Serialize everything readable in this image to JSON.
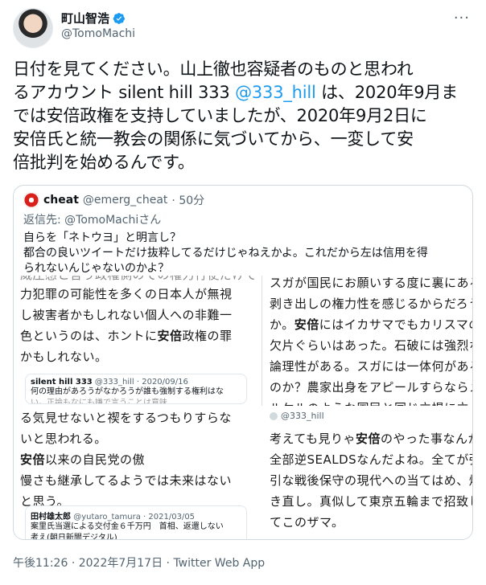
{
  "author": {
    "name": "町山智浩",
    "handle": "@TomoMachi"
  },
  "tweet": {
    "line1": "日付を見てください。山上徹也容疑者のものと思われ",
    "line2_before": "るアカウント silent hill 333 ",
    "line2_mention": "@333_hill",
    "line2_after": " は、2020年9月ま",
    "line3": "では安倍政権を支持していましたが、2020年9月2日に",
    "line4": "安倍氏と統一教会の関係に気づいてから、一変して安",
    "line5": "倍批判を始めるんです。"
  },
  "quote": {
    "name": "cheat",
    "handle": "@emerg_cheat",
    "time": "· 50分",
    "reply_to": "返信先: @TomoMachiさん",
    "text_line1": "自らを「ネトウヨ」と明言し？",
    "text_line2": "都合の良いツイートだけ抜粋してるだけじゃねえかよ。これだから左は信用を得",
    "text_line3": "られないんじゃないのかよ？"
  },
  "images": {
    "left": {
      "top_line0": "威圧感と言う政権側のでの権力行使だけで権",
      "top_line1": "力犯罪の可能性を多くの日本人が無視",
      "top_line2": "し被害者かもしれない個人への非難一",
      "top_line3a": "色というのは、ホントに",
      "top_line3b": "安倍",
      "top_line3c": "政権の罪",
      "top_line4": "かもしれない。",
      "card1_name": "silent hill 333",
      "card1_meta": "@333_hill · 2020/09/16",
      "card1_line1": "何の理由があろうがなかろうが誰も強制する権利はな",
      "card1_line2": "い。正論もなにも嫌で言うことは意味",
      "mid_line1": "る気見せないと禊をするつもりすらな",
      "mid_line2": "いと思われる。",
      "mid_line3a": "安倍",
      "mid_line3b": "以来の自民党の傲",
      "mid_line4": "慢さも継承してるようでは未来はない",
      "mid_line5": "と思う。",
      "card2_name": "田村雄太郎",
      "card2_meta": "@yutaro_tamura · 2021/03/05",
      "card2_line1": "案里氏当選による交付金６千万円　首相、返還しない",
      "card2_line2": "考え(朝日新聞デジタル)"
    },
    "right_top": {
      "line1": "スガが国民にお願いする度に裏にある",
      "line2": "剥き出しの権力性を感じるからだろう",
      "line3a": "か。",
      "line3b": "安倍",
      "line3c": "にはイカサマでもカリスマの",
      "line4": "欠片ぐらいはあった。石破には強烈な",
      "line5": "論理性がある。スガには一体何がある",
      "line6": "のか？農家出身をアピールすらならメ",
      "line7": "ルケルのような国民と同じ立場に立っ"
    },
    "right_bottom": {
      "handle": "@333_hill",
      "line1a": "考えても見りゃ",
      "line1b": "安倍",
      "line1c": "のやった事なんか",
      "line2": "全部逆SEALDSなんだよね。全てが強",
      "line3": "引な戦後保守の現代への当てはめ、焼",
      "line4": "き直し。真似して東京五輪まで招致し",
      "line5": "てこのザマ。"
    }
  },
  "footer": {
    "time": "午後11:26",
    "date": "2022年7月17日",
    "client": "Twitter Web App"
  },
  "colors": {
    "accent": "#1d9bf0",
    "muted": "#536471",
    "border": "#cfd9de"
  },
  "icons": {
    "verified": "verified-badge-icon",
    "more": "more-options-icon"
  }
}
